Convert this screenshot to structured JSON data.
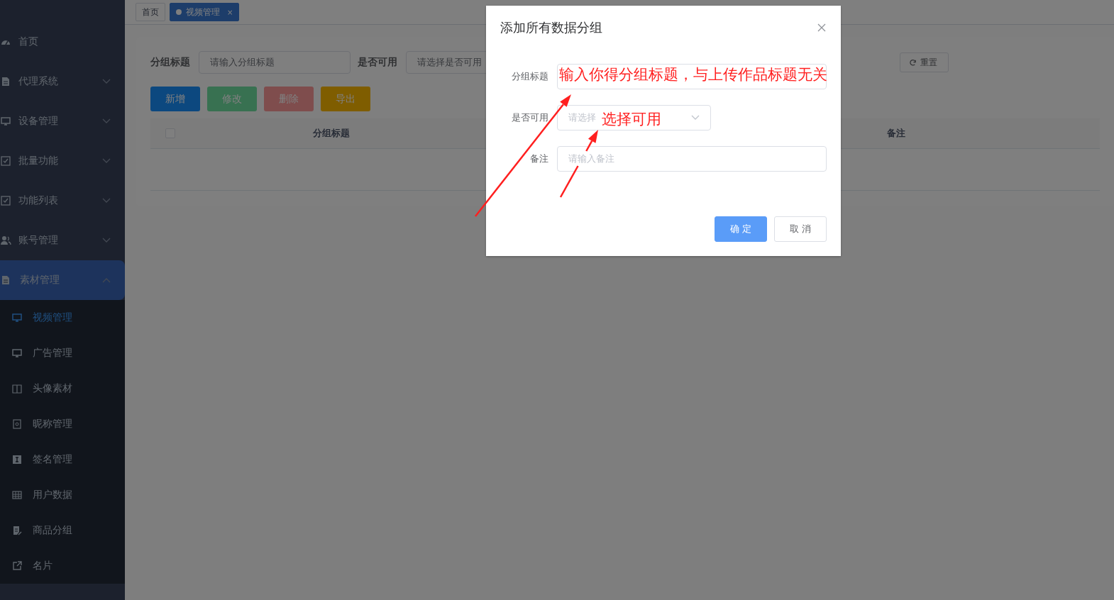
{
  "sidebar": {
    "items": [
      {
        "label": "首页",
        "kind": "link"
      },
      {
        "label": "代理系统",
        "kind": "group",
        "expanded": false
      },
      {
        "label": "设备管理",
        "kind": "group",
        "expanded": false
      },
      {
        "label": "批量功能",
        "kind": "group",
        "expanded": false
      },
      {
        "label": "功能列表",
        "kind": "group",
        "expanded": false
      },
      {
        "label": "账号管理",
        "kind": "group",
        "expanded": false
      },
      {
        "label": "素材管理",
        "kind": "group",
        "expanded": true,
        "children": [
          {
            "label": "视频管理",
            "selected": true
          },
          {
            "label": "广告管理",
            "selected": false
          },
          {
            "label": "头像素材",
            "selected": false
          },
          {
            "label": "昵称管理",
            "selected": false
          },
          {
            "label": "签名管理",
            "selected": false
          },
          {
            "label": "用户数据",
            "selected": false
          },
          {
            "label": "商品分组",
            "selected": false
          },
          {
            "label": "名片",
            "selected": false
          }
        ]
      }
    ]
  },
  "tags": [
    {
      "label": "首页",
      "selected": false
    },
    {
      "label": "视频管理",
      "selected": true,
      "close": "×"
    }
  ],
  "filter": {
    "fields": [
      {
        "label": "分组标题",
        "kind": "input",
        "placeholder": "请输入分组标题"
      },
      {
        "label": "是否可用",
        "kind": "select",
        "placeholder": "请选择是否可用"
      }
    ],
    "reset_button": "重置"
  },
  "toolbar": [
    {
      "label": "新增",
      "kind": "primary",
      "disabled": false
    },
    {
      "label": "修改",
      "kind": "success",
      "disabled": true
    },
    {
      "label": "删除",
      "kind": "danger",
      "disabled": true
    },
    {
      "label": "导出",
      "kind": "warning",
      "disabled": false
    }
  ],
  "table": {
    "select_all_checked": false,
    "columns": [
      "分组标题",
      "备注"
    ]
  },
  "dialog": {
    "title": "添加所有数据分组",
    "fields": [
      {
        "label": "分组标题",
        "kind": "input"
      },
      {
        "label": "是否可用",
        "kind": "select",
        "placeholder": "请选择"
      },
      {
        "label": "备注",
        "kind": "input",
        "placeholder": "请输入备注"
      }
    ],
    "buttons": [
      {
        "label": "确 定",
        "kind": "primary"
      },
      {
        "label": "取 消",
        "kind": "default"
      }
    ]
  },
  "annotations": [
    {
      "text": "输入你得分组标题，与上传作品标题无关"
    },
    {
      "text": "选择可用"
    }
  ]
}
